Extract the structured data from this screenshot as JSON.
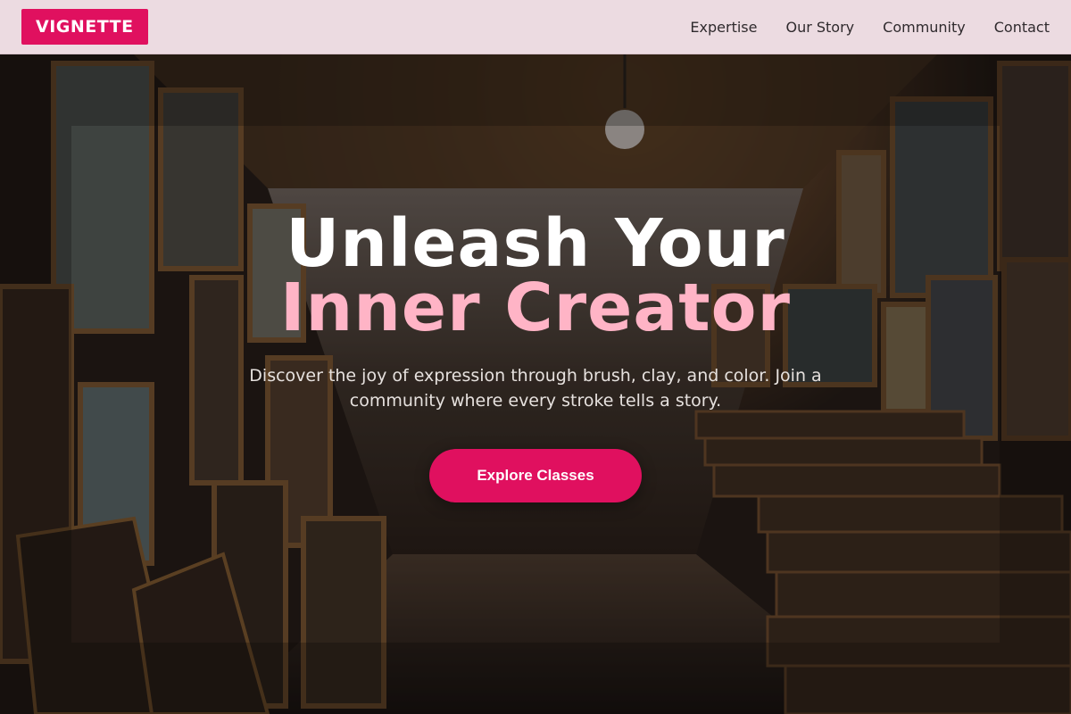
{
  "nav": {
    "logo": "VIGNETTE",
    "links": [
      "Expertise",
      "Our Story",
      "Community",
      "Contact"
    ]
  },
  "hero": {
    "headline_line1": "Unleash Your",
    "headline_line2": "Inner Creator",
    "subtitle": "Discover the joy of expression through brush, clay, and color. Join a community where every stroke tells a story.",
    "cta_label": "Explore Classes"
  },
  "colors": {
    "brand": "#e0105f",
    "nav_background": "#ecdbe1",
    "headline_accent": "#ffb4c6",
    "headline_primary": "#ffffff"
  }
}
